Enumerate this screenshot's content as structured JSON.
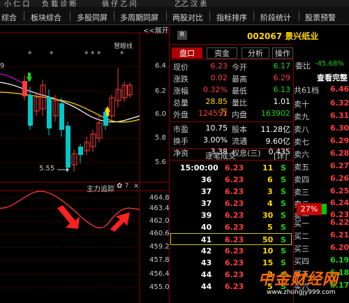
{
  "menu": {
    "top_fragments": [
      "小 仁 口",
      "负 载 诊 断",
      "倘 仔 乙 问",
      "乙乙 汉 表"
    ],
    "items": [
      "综合",
      "板块综合",
      "多股同屏",
      "多周期同屏",
      "两股对比",
      "指标排序",
      "阶段统计",
      "股票预警"
    ]
  },
  "chart": {
    "expand_label": "<<展开",
    "indicator_name": "慧眼线",
    "stars": [
      "*",
      "*",
      "* * *",
      "*"
    ],
    "price_axis": [
      "6.4",
      "6.2",
      "6.0",
      "5.8",
      "5.6"
    ],
    "low_marker": "5.55",
    "left_edge_label": "9",
    "sub_indicator": "主力追踪",
    "sub_axis": [
      "464.8",
      "463.4",
      "462.0",
      "460.6",
      "459.2",
      "457.8",
      "456.4",
      "455.0"
    ]
  },
  "chart_data": {
    "type": "candlestick",
    "price_ticks": [
      6.4,
      6.2,
      6.0,
      5.8,
      5.6
    ],
    "low_point": 5.55,
    "sub_ticks": [
      464.8,
      463.4,
      462.0,
      460.6,
      459.2,
      457.8,
      456.4,
      455.0
    ]
  },
  "stock": {
    "badge": "R",
    "code_name": "002067 景兴纸业",
    "tabs": [
      "盘口",
      "资金",
      "分析",
      "操作"
    ]
  },
  "quote": {
    "rows": [
      [
        "现价",
        "6.23",
        "今开",
        "6.17"
      ],
      [
        "涨跌",
        "0.02",
        "最高",
        "6.29"
      ],
      [
        "涨幅",
        "0.32%",
        "最低",
        "6.13"
      ],
      [
        "总量",
        "28.85万",
        "量比",
        "1.01"
      ],
      [
        "外盘",
        "124551",
        "内盘",
        "163902"
      ],
      [
        "市盈",
        "10.75",
        "股本",
        "11.28亿"
      ],
      [
        "换手",
        "3.00%",
        "流通",
        "9.60亿"
      ],
      [
        "净资",
        "3.38",
        "权息(三)",
        "0.435"
      ]
    ]
  },
  "ticks": {
    "title": "逐笔成交",
    "detail": "[详]",
    "rows": [
      [
        "15:00:00",
        "6.23",
        "11",
        "S"
      ],
      [
        "36",
        "6.23",
        "6",
        "S"
      ],
      [
        "37",
        "6.23",
        "3",
        "S"
      ],
      [
        "37",
        "6.23",
        "4",
        "S"
      ],
      [
        "39",
        "6.23",
        "30",
        "S"
      ],
      [
        "40",
        "6.23",
        "5",
        "S"
      ],
      [
        "41",
        "6.23",
        "50",
        "S"
      ],
      [
        "42",
        "6.23",
        "10",
        "S"
      ],
      [
        "43",
        "6.23",
        "15",
        "S"
      ],
      [
        "44",
        "6.23",
        "8",
        "S"
      ],
      [
        "44",
        "6.23",
        "5",
        "S"
      ]
    ]
  },
  "orderbook": {
    "ratio_label": "委比",
    "ratio_value": "-45.68%",
    "more": "查看完整",
    "levels_label": "共61档",
    "asks": [
      [
        "卖十",
        "6.32"
      ],
      [
        "卖九",
        "6.31"
      ],
      [
        "卖八",
        "6.30"
      ],
      [
        "卖七",
        "6.29"
      ],
      [
        "卖六",
        "6.28"
      ],
      [
        "卖五",
        "6.27"
      ],
      [
        "卖四",
        "6.26"
      ],
      [
        "卖三",
        "6.25"
      ],
      [
        "卖二",
        "6.24"
      ],
      [
        "卖一",
        "6.23"
      ]
    ],
    "first_price": "6.46",
    "bar_pct": "27%",
    "bids": [
      [
        "买一",
        "6.22"
      ],
      [
        "买二",
        "6.21"
      ],
      [
        "买三",
        "6.20"
      ],
      [
        "买四",
        "6.19"
      ],
      [
        "买五",
        "6.18"
      ],
      [
        "买六",
        "6.17"
      ]
    ]
  },
  "watermark": {
    "text": "中金财经网",
    "url": "www.zhongjy999.com"
  }
}
